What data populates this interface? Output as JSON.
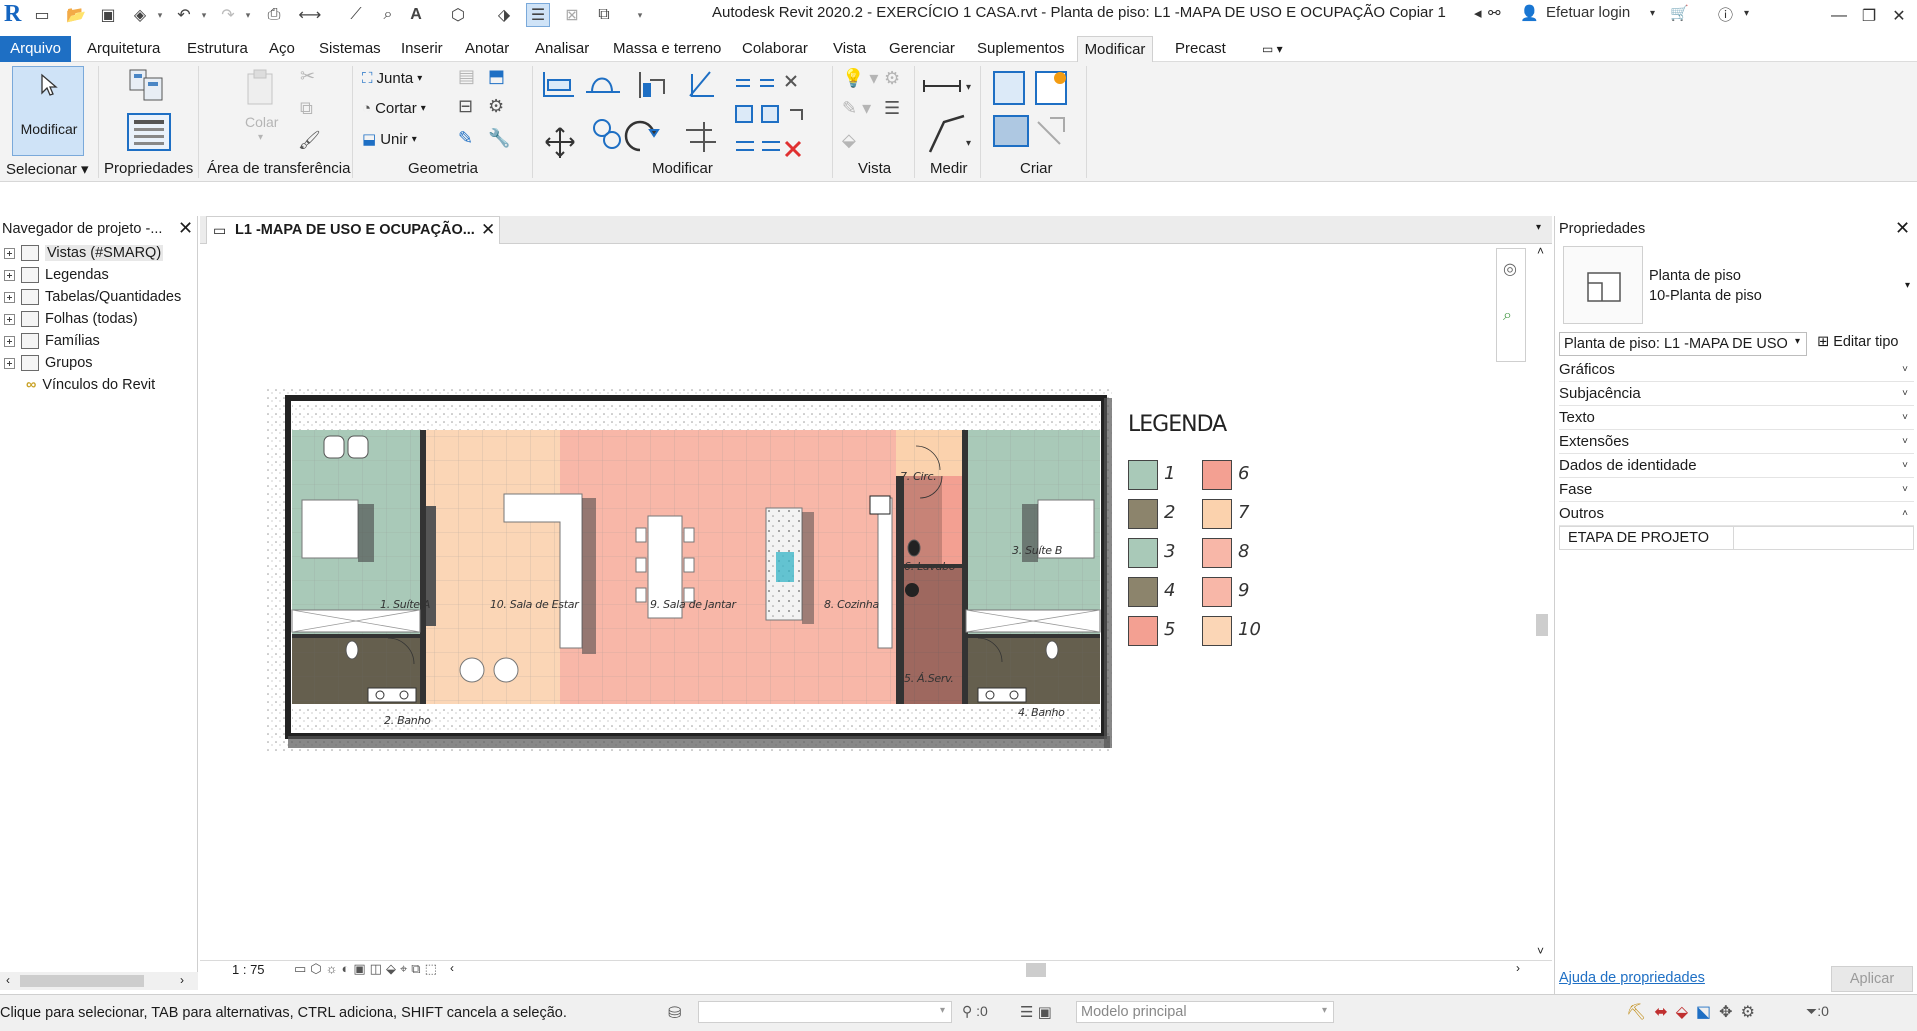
{
  "titlebar": {
    "title": "Autodesk Revit 2020.2 - EXERCÍCIO 1 CASA.rvt - Planta de piso: L1 -MAPA DE USO E OCUPAÇÃO Copiar 1",
    "login": "Efetuar login",
    "icons": [
      "revit-logo",
      "open",
      "save",
      "sync",
      "undo",
      "redo",
      "print",
      "measure",
      "text",
      "close-inactive",
      "thin-lines"
    ]
  },
  "menu": {
    "items": [
      "Arquivo",
      "Arquitetura",
      "Estrutura",
      "Aço",
      "Sistemas",
      "Inserir",
      "Anotar",
      "Analisar",
      "Massa e terreno",
      "Colaborar",
      "Vista",
      "Gerenciar",
      "Suplementos",
      "Modificar",
      "Precast"
    ],
    "active": "Modificar",
    "accent_color": "#1e6fc4"
  },
  "ribbon": {
    "modify_label": "Modificar",
    "panels": {
      "selecionar": "Selecionar",
      "propriedades": "Propriedades",
      "transferencia": "Área de transferência",
      "geometria": "Geometria",
      "modificar": "Modificar",
      "vista": "Vista",
      "medir": "Medir",
      "criar": "Criar"
    },
    "colar_label": "Colar",
    "geometry_buttons": [
      "Junta",
      "Cortar",
      "Unir"
    ]
  },
  "navigator": {
    "title": "Navegador de projeto -...",
    "items": [
      "Vistas (#SMARQ)",
      "Legendas",
      "Tabelas/Quantidades",
      "Folhas (todas)",
      "Famílias",
      "Grupos",
      "Vínculos do Revit"
    ]
  },
  "view": {
    "tab_title": "L1 -MAPA DE USO E OCUPAÇÃO...",
    "scale": "1 : 75",
    "legend_title": "LEGENDA",
    "legend": [
      {
        "num": "1",
        "color": "#a9c9b8"
      },
      {
        "num": "2",
        "color": "#8c846c"
      },
      {
        "num": "3",
        "color": "#a9c9b8"
      },
      {
        "num": "4",
        "color": "#8c846c"
      },
      {
        "num": "5",
        "color": "#f3a092"
      },
      {
        "num": "6",
        "color": "#f3a092"
      },
      {
        "num": "7",
        "color": "#fbd2ad"
      },
      {
        "num": "8",
        "color": "#f8b7a8"
      },
      {
        "num": "9",
        "color": "#f8b7a8"
      },
      {
        "num": "10",
        "color": "#fbd6b6"
      }
    ],
    "rooms": {
      "suite_a": "1. Suíte A",
      "banho": "2. Banho",
      "sala_estar": "10. Sala de Estar",
      "sala_jantar": "9. Sala de Jantar",
      "cozinha": "8. Cozinha",
      "circ": "7. Circ.",
      "lavabo": "6. Lavabo",
      "aserv": "5. Á.Serv.",
      "suite_b": "3. Suíte B",
      "banho_b": "4. Banho"
    }
  },
  "properties": {
    "title": "Propriedades",
    "type_line1": "Planta de piso",
    "type_line2": "10-Planta de piso",
    "selector": "Planta de piso: L1 -MAPA DE USO",
    "edit_type": "Editar tipo",
    "groups": [
      "Gráficos",
      "Subjacência",
      "Texto",
      "Extensões",
      "Dados de identidade",
      "Fase",
      "Outros"
    ],
    "param_name": "ETAPA DE PROJETO",
    "param_value": "",
    "help_link": "Ajuda de propriedades",
    "apply": "Aplicar"
  },
  "status": {
    "message": "Clique para selecionar, TAB para alternativas, CTRL adiciona, SHIFT cancela a seleção.",
    "workset_value": ":0",
    "model": "Modelo principal",
    "filter_count": ":0"
  }
}
